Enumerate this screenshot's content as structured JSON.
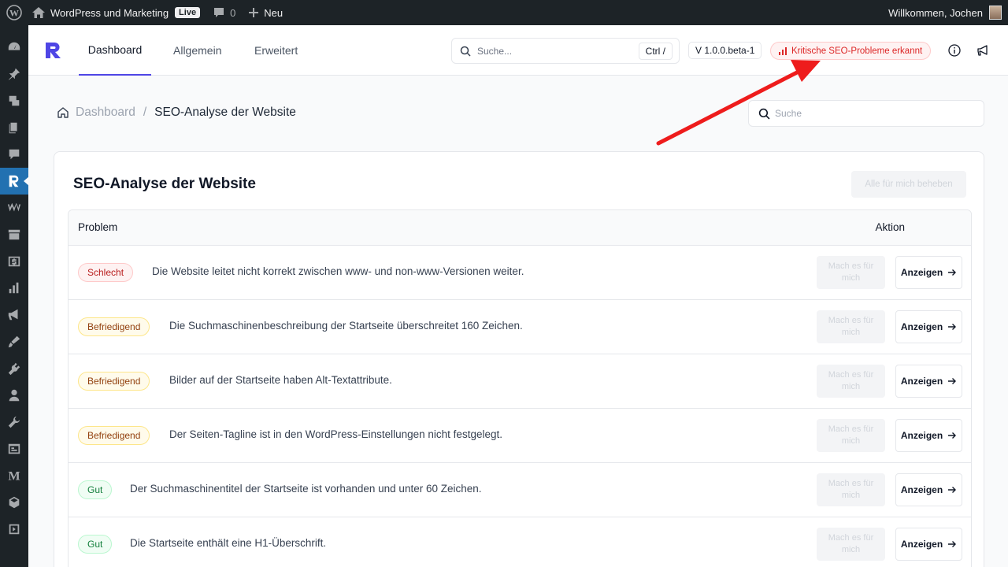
{
  "adminbar": {
    "site_name": "WordPress und Marketing",
    "live": "Live",
    "comments_count": "0",
    "new_label": "Neu",
    "greeting": "Willkommen, Jochen"
  },
  "topnav": {
    "tabs": [
      {
        "label": "Dashboard"
      },
      {
        "label": "Allgemein"
      },
      {
        "label": "Erweitert"
      }
    ],
    "search_placeholder": "Suche...",
    "search_shortcut": "Ctrl /",
    "version": "V 1.0.0.beta-1",
    "alert": "Kritische SEO-Probleme erkannt"
  },
  "breadcrumb": {
    "root": "Dashboard",
    "separator": "/",
    "current": "SEO-Analyse der Website"
  },
  "page_search_placeholder": "Suche",
  "card": {
    "title": "SEO-Analyse der Website",
    "fix_all": "Alle für mich beheben",
    "col_problem": "Problem",
    "col_action": "Aktion",
    "fix_label": "Mach es für mich",
    "show_label": "Anzeigen",
    "rows": [
      {
        "status": "Schlecht",
        "text": "Die Website leitet nicht korrekt zwischen www- und non-www-Versionen weiter."
      },
      {
        "status": "Befriedigend",
        "text": "Die Suchmaschinenbeschreibung der Startseite überschreitet 160 Zeichen."
      },
      {
        "status": "Befriedigend",
        "text": "Bilder auf der Startseite haben Alt-Textattribute."
      },
      {
        "status": "Befriedigend",
        "text": "Der Seiten-Tagline ist in den WordPress-Einstellungen nicht festgelegt."
      },
      {
        "status": "Gut",
        "text": "Der Suchmaschinentitel der Startseite ist vorhanden und unter 60 Zeichen."
      },
      {
        "status": "Gut",
        "text": "Die Startseite enthält eine H1-Überschrift."
      }
    ]
  },
  "colors": {
    "accent": "#4f46e5",
    "wp_bar": "#1d2327",
    "wp_active": "#2271b1",
    "critical": "#dc2626",
    "annotation_arrow": "#ee1c1c"
  },
  "icons": {
    "adminbar": [
      "wordpress-icon",
      "home-icon",
      "comment-icon",
      "plus-icon"
    ],
    "menu": [
      "dashboard-icon",
      "pin-icon",
      "media-icon",
      "pages-icon",
      "comments-icon",
      "rankmath-icon",
      "woo-icon",
      "archive-icon",
      "dollar-icon",
      "analytics-icon",
      "megaphone-icon",
      "appearance-icon",
      "plugins-icon",
      "users-icon",
      "tools-icon",
      "settings-icon",
      "m-icon",
      "box-icon",
      "collapse-icon"
    ]
  }
}
